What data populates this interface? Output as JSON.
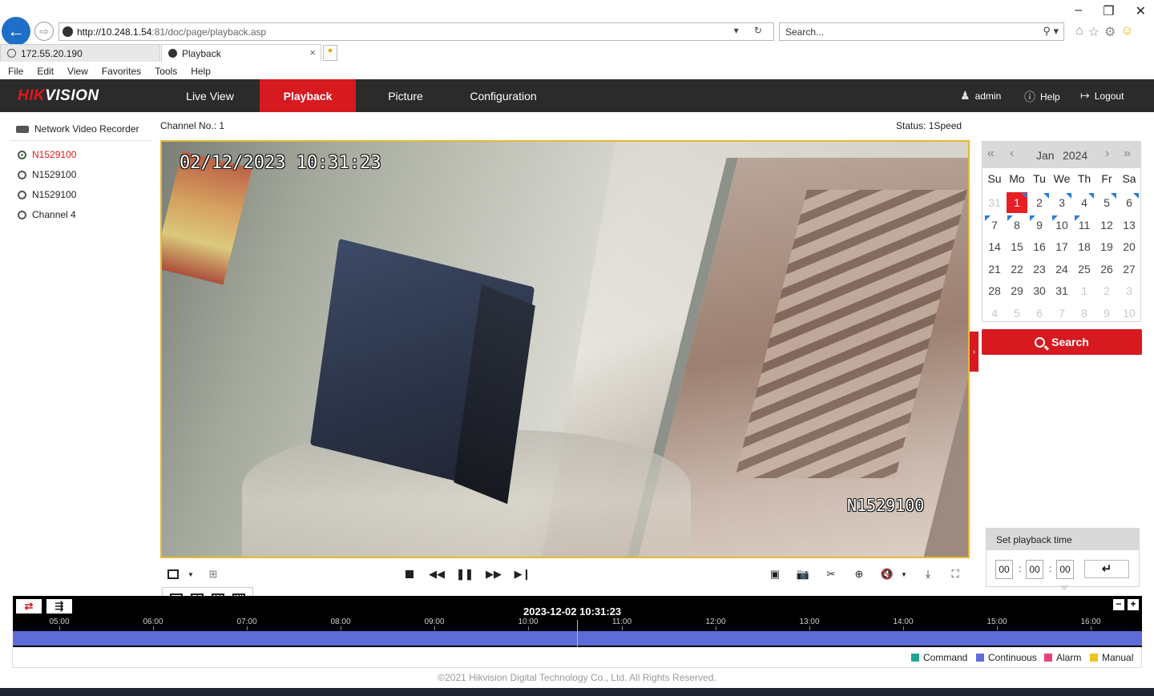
{
  "browser": {
    "url_host": "http://10.248.1.54",
    "url_rest": ":81/doc/page/playback.asp",
    "search_placeholder": "Search...",
    "tabs": [
      {
        "label": "172.55.20.190"
      },
      {
        "label": "Playback",
        "close": "×"
      }
    ],
    "menu": [
      "File",
      "Edit",
      "View",
      "Favorites",
      "Tools",
      "Help"
    ],
    "window_controls": [
      "–",
      "❐",
      "✕"
    ]
  },
  "app": {
    "logo_hik": "HIK",
    "logo_vision": "VISION",
    "nav": [
      "Live View",
      "Playback",
      "Picture",
      "Configuration"
    ],
    "active_nav": "Playback",
    "user": "admin",
    "help": "Help",
    "logout": "Logout"
  },
  "tree": {
    "root": "Network Video Recorder",
    "items": [
      {
        "label": "N1529100",
        "active": true
      },
      {
        "label": "N1529100",
        "active": false
      },
      {
        "label": "N1529100",
        "active": false
      },
      {
        "label": "Channel 4",
        "active": false
      }
    ]
  },
  "player": {
    "channel_label": "Channel No.: 1",
    "status_label": "Status: 1Speed",
    "osd_timestamp": "02/12/2023 10:31:23",
    "osd_name": "N1529100"
  },
  "timeline": {
    "current_time": "2023-12-02 10:31:23",
    "ticks": [
      "05:00",
      "06:00",
      "07:00",
      "08:00",
      "09:00",
      "10:00",
      "11:00",
      "12:00",
      "13:00",
      "14:00",
      "15:00",
      "16:00"
    ],
    "zoom_out": "−",
    "zoom_in": "+",
    "legend": [
      {
        "label": "Command",
        "color": "#1fa693"
      },
      {
        "label": "Continuous",
        "color": "#5e6cd8"
      },
      {
        "label": "Alarm",
        "color": "#e8407a"
      },
      {
        "label": "Manual",
        "color": "#f0c419"
      }
    ]
  },
  "calendar": {
    "month": "Jan",
    "year": "2024",
    "dow": [
      "Su",
      "Mo",
      "Tu",
      "We",
      "Th",
      "Fr",
      "Sa"
    ],
    "days": [
      {
        "d": "31",
        "other": true
      },
      {
        "d": "1",
        "sel": true,
        "rec": true
      },
      {
        "d": "2",
        "rec": true
      },
      {
        "d": "3",
        "rec": true
      },
      {
        "d": "4",
        "rec": true
      },
      {
        "d": "5",
        "rec": true
      },
      {
        "d": "6",
        "rec": true
      },
      {
        "d": "7",
        "recbl": true
      },
      {
        "d": "8",
        "recbl": true
      },
      {
        "d": "9",
        "recbl": true
      },
      {
        "d": "10",
        "recbl": true
      },
      {
        "d": "11",
        "recbl": true
      },
      {
        "d": "12"
      },
      {
        "d": "13"
      },
      {
        "d": "14"
      },
      {
        "d": "15"
      },
      {
        "d": "16"
      },
      {
        "d": "17"
      },
      {
        "d": "18"
      },
      {
        "d": "19"
      },
      {
        "d": "20"
      },
      {
        "d": "21"
      },
      {
        "d": "22"
      },
      {
        "d": "23"
      },
      {
        "d": "24"
      },
      {
        "d": "25"
      },
      {
        "d": "26"
      },
      {
        "d": "27"
      },
      {
        "d": "28"
      },
      {
        "d": "29"
      },
      {
        "d": "30"
      },
      {
        "d": "31"
      },
      {
        "d": "1",
        "other": true
      },
      {
        "d": "2",
        "other": true
      },
      {
        "d": "3",
        "other": true
      },
      {
        "d": "4",
        "other": true
      },
      {
        "d": "5",
        "other": true
      },
      {
        "d": "6",
        "other": true
      },
      {
        "d": "7",
        "other": true
      },
      {
        "d": "8",
        "other": true
      },
      {
        "d": "9",
        "other": true
      },
      {
        "d": "10",
        "other": true
      }
    ],
    "search_label": "Search"
  },
  "playback_time": {
    "title": "Set playback time",
    "hh": "00",
    "mm": "00",
    "ss": "00",
    "sep": ":"
  },
  "footer": "©2021 Hikvision Digital Technology Co., Ltd. All Rights Reserved.",
  "colors": {
    "brand_red": "#d71920",
    "header_dark": "#2b2b2b",
    "osd_border": "#e5b83a"
  }
}
